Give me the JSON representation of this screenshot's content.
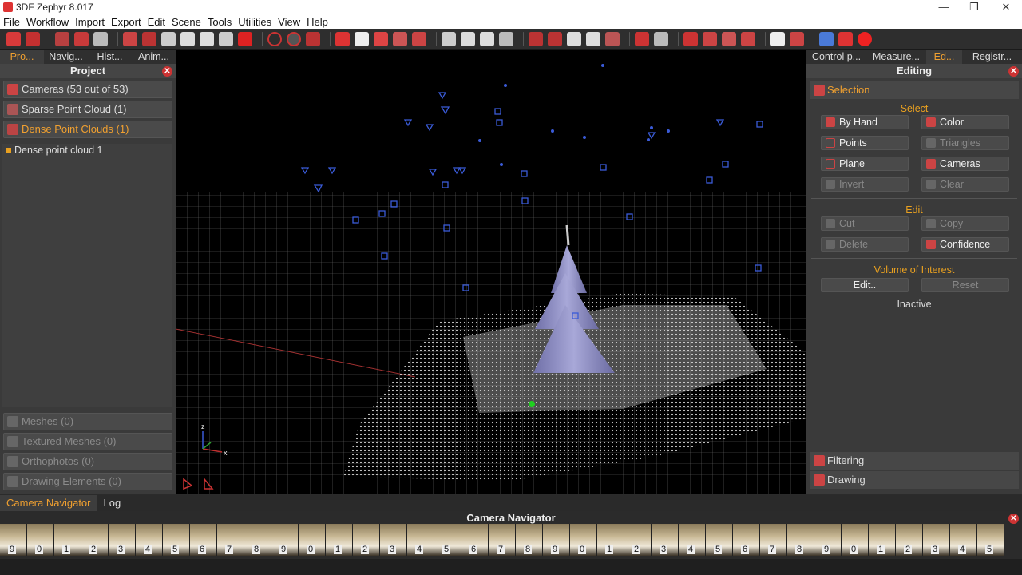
{
  "window": {
    "title": "3DF Zephyr 8.017",
    "min": "—",
    "max": "❐",
    "close": "✕"
  },
  "menu": [
    "File",
    "Workflow",
    "Import",
    "Export",
    "Edit",
    "Scene",
    "Tools",
    "Utilities",
    "View",
    "Help"
  ],
  "left_tabs": [
    "Pro...",
    "Navig...",
    "Hist...",
    "Anim..."
  ],
  "project": {
    "title": "Project",
    "items": [
      {
        "label": "Cameras (53 out of 53)"
      },
      {
        "label": "Sparse Point Cloud (1)"
      },
      {
        "label": "Dense Point Clouds (1)"
      }
    ],
    "sub_item": "Dense point cloud 1",
    "disabled_items": [
      {
        "label": "Meshes (0)"
      },
      {
        "label": "Textured Meshes (0)"
      },
      {
        "label": "Orthophotos (0)"
      },
      {
        "label": "Drawing Elements (0)"
      }
    ]
  },
  "viewport": {
    "axis_z": "z",
    "axis_x": "x"
  },
  "right_tabs": [
    "Control p...",
    "Measure...",
    "Ed...",
    "Registr..."
  ],
  "editing": {
    "title": "Editing",
    "selection": "Selection",
    "select_label": "Select",
    "select_buttons": [
      {
        "label": "By Hand"
      },
      {
        "label": "Color"
      },
      {
        "label": "Points"
      },
      {
        "label": "Triangles"
      },
      {
        "label": "Plane"
      },
      {
        "label": "Cameras"
      },
      {
        "label": "Invert"
      },
      {
        "label": "Clear"
      }
    ],
    "edit_label": "Edit",
    "edit_buttons": [
      {
        "label": "Cut"
      },
      {
        "label": "Copy"
      },
      {
        "label": "Delete"
      },
      {
        "label": "Confidence"
      }
    ],
    "voi_label": "Volume of Interest",
    "voi_edit": "Edit..",
    "voi_reset": "Reset",
    "voi_status": "Inactive",
    "filtering": "Filtering",
    "drawing": "Drawing"
  },
  "bottom_tabs": [
    "Camera Navigator",
    "Log"
  ],
  "camera_navigator": {
    "title": "Camera Navigator",
    "thumb_numbers": [
      "9",
      "0",
      "1",
      "2",
      "3",
      "4",
      "5",
      "6",
      "7",
      "8",
      "9",
      "0",
      "1",
      "2",
      "3",
      "4",
      "5",
      "6",
      "7",
      "8",
      "9",
      "0",
      "1",
      "2",
      "3",
      "4",
      "5",
      "6",
      "7",
      "8",
      "9",
      "0",
      "1",
      "2",
      "3",
      "4",
      "5"
    ]
  },
  "colors": {
    "accent": "#f0a030",
    "close": "#cc3333",
    "camera_marker": "#3a5bd8",
    "tree": "#8e8ec8"
  }
}
